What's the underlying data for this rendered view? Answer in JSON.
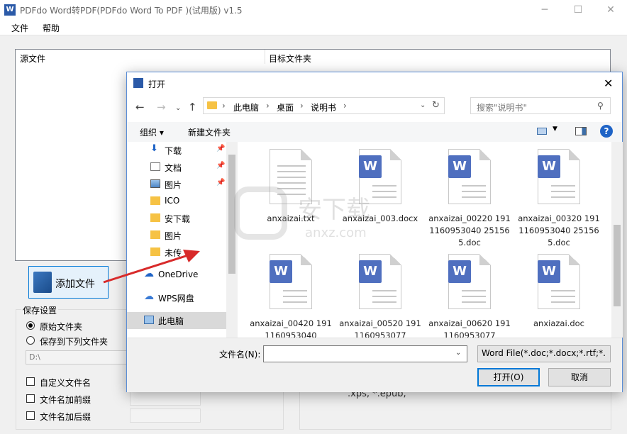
{
  "window": {
    "title": "PDFdo Word转PDF(PDFdo Word To PDF )(试用版) v1.5",
    "menus": [
      "文件",
      "帮助"
    ]
  },
  "table": {
    "col_source": "源文件",
    "col_target": "目标文件夹"
  },
  "add_button_label": "添加文件",
  "save_settings": {
    "title": "保存设置",
    "radio_original": "原始文件夹",
    "radio_custom": "保存到下列文件夹",
    "dir_value": "D:\\",
    "check_custom_name": "自定义文件名",
    "check_prefix": "文件名加前缀",
    "check_suffix": "文件名加后缀"
  },
  "partial_text": ".xps, *.epub,",
  "dialog": {
    "title": "打开",
    "breadcrumb": [
      "此电脑",
      "桌面",
      "说明书"
    ],
    "search_placeholder": "搜索\"说明书\"",
    "organize": "组织 ▾",
    "new_folder": "新建文件夹",
    "nav_items": [
      {
        "label": "下载",
        "icon": "download-icon"
      },
      {
        "label": "文档",
        "icon": "document-icon"
      },
      {
        "label": "图片",
        "icon": "picture-icon"
      },
      {
        "label": "ICO",
        "icon": "folder-icon"
      },
      {
        "label": "安下载",
        "icon": "folder-icon"
      },
      {
        "label": "图片",
        "icon": "folder-icon"
      },
      {
        "label": "未传",
        "icon": "folder-icon"
      },
      {
        "label": "OneDrive",
        "icon": "cloud-icon"
      },
      {
        "label": "WPS网盘",
        "icon": "cloud-icon"
      },
      {
        "label": "此电脑",
        "icon": "computer-icon"
      }
    ],
    "files": [
      {
        "name": "anxaizai.txt",
        "type": "txt"
      },
      {
        "name": "anxaizai_003.docx",
        "type": "word"
      },
      {
        "name": "anxaizai_00220 1911160953040 251565.doc",
        "type": "word"
      },
      {
        "name": "anxaizai_00320 1911160953040 251565.doc",
        "type": "word"
      },
      {
        "name": "anxaizai_00420 1911160953040",
        "type": "word"
      },
      {
        "name": "anxaizai_00520 1911160953077",
        "type": "word"
      },
      {
        "name": "anxaizai_00620 1911160953077",
        "type": "word"
      },
      {
        "name": "anxiazai.doc",
        "type": "word"
      }
    ],
    "filename_label": "文件名(N):",
    "filename_value": "",
    "filter": "Word File(*.doc;*.docx;*.rtf;*.",
    "open_label": "打开(O)",
    "cancel_label": "取消"
  },
  "watermark": {
    "main": "安下载",
    "sub": "anxz.com"
  },
  "colors": {
    "accent": "#0078d7",
    "word_badge": "#4f6fbf",
    "arrow": "#d82a2a"
  }
}
